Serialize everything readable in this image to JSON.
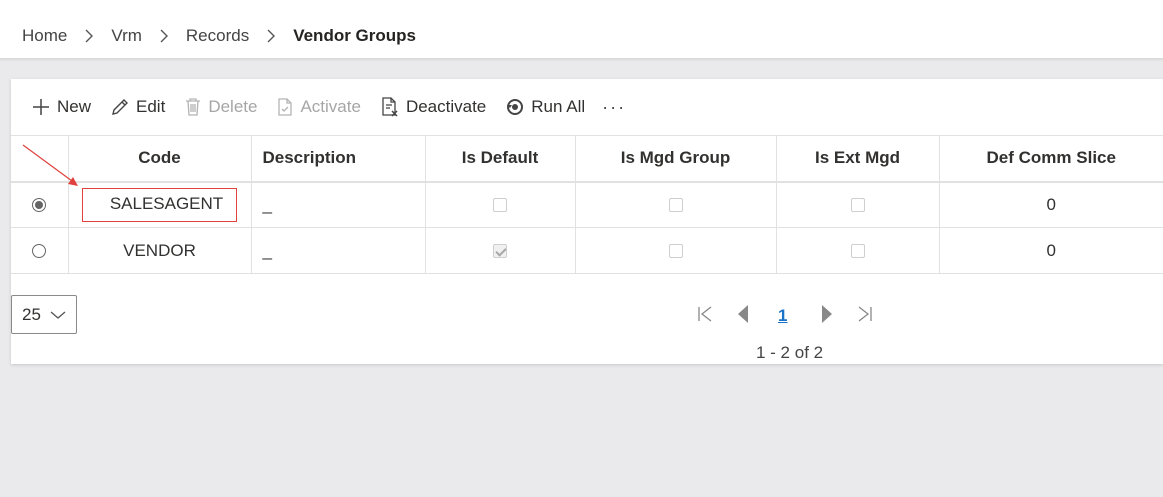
{
  "breadcrumb": {
    "items": [
      "Home",
      "Vrm",
      "Records"
    ],
    "current": "Vendor Groups"
  },
  "toolbar": {
    "new_label": "New",
    "edit_label": "Edit",
    "delete_label": "Delete",
    "activate_label": "Activate",
    "deactivate_label": "Deactivate",
    "run_all_label": "Run All",
    "more_label": "···"
  },
  "grid": {
    "columns": [
      "Code",
      "Description",
      "Is Default",
      "Is Mgd Group",
      "Is Ext Mgd",
      "Def Comm Slice"
    ],
    "rows": [
      {
        "selected": true,
        "code": "SALESAGENT",
        "description": "_",
        "is_default": false,
        "is_mgd_group": false,
        "is_ext_mgd": false,
        "def_comm_slice": "0"
      },
      {
        "selected": false,
        "code": "VENDOR",
        "description": "_",
        "is_default": true,
        "is_mgd_group": false,
        "is_ext_mgd": false,
        "def_comm_slice": "0"
      }
    ]
  },
  "pager": {
    "page_size": "25",
    "current_page": "1",
    "info": "1 - 2 of 2"
  },
  "colors": {
    "annotation_red": "#e0413c",
    "page_link": "#1a73c8"
  }
}
